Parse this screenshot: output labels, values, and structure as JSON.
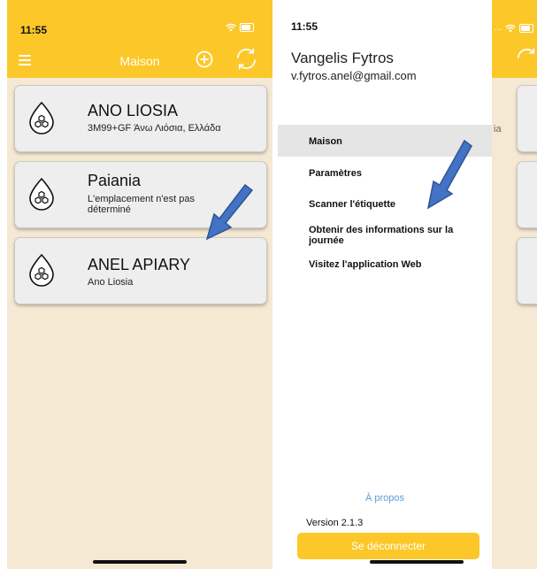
{
  "status_bar": {
    "time": "11:55"
  },
  "home": {
    "title": "Maison",
    "apiaries": [
      {
        "name": "ANO LIOSIA",
        "location": "3M99+GF Άνω Λιόσια, Ελλάδα"
      },
      {
        "name": "Paiania",
        "location": "L'emplacement n'est pas déterminé"
      },
      {
        "name": "ANEL APIARY",
        "location": "Ano Liosia"
      }
    ]
  },
  "drawer": {
    "user_name": "Vangelis Fytros",
    "user_email": "v.fytros.anel@gmail.com",
    "menu": [
      {
        "label": "Maison",
        "selected": true
      },
      {
        "label": "Paramètres"
      },
      {
        "label": "Scanner l'étiquette"
      },
      {
        "label": "Obtenir des informations sur la journée"
      },
      {
        "label": "Visitez l'application Web"
      }
    ],
    "about": "À propos",
    "version": "Version 2.1.3",
    "logout": "Se déconnecter"
  },
  "peek": {
    "partial_text": "ia"
  },
  "colors": {
    "accent_yellow": "#fcc829",
    "background_beige": "#f5e9d3",
    "arrow_blue": "#4472c4",
    "link_blue": "#5b9bd5"
  },
  "icons": [
    "menu-icon",
    "add-icon",
    "refresh-icon",
    "hive-icon",
    "wifi-icon",
    "battery-icon"
  ]
}
